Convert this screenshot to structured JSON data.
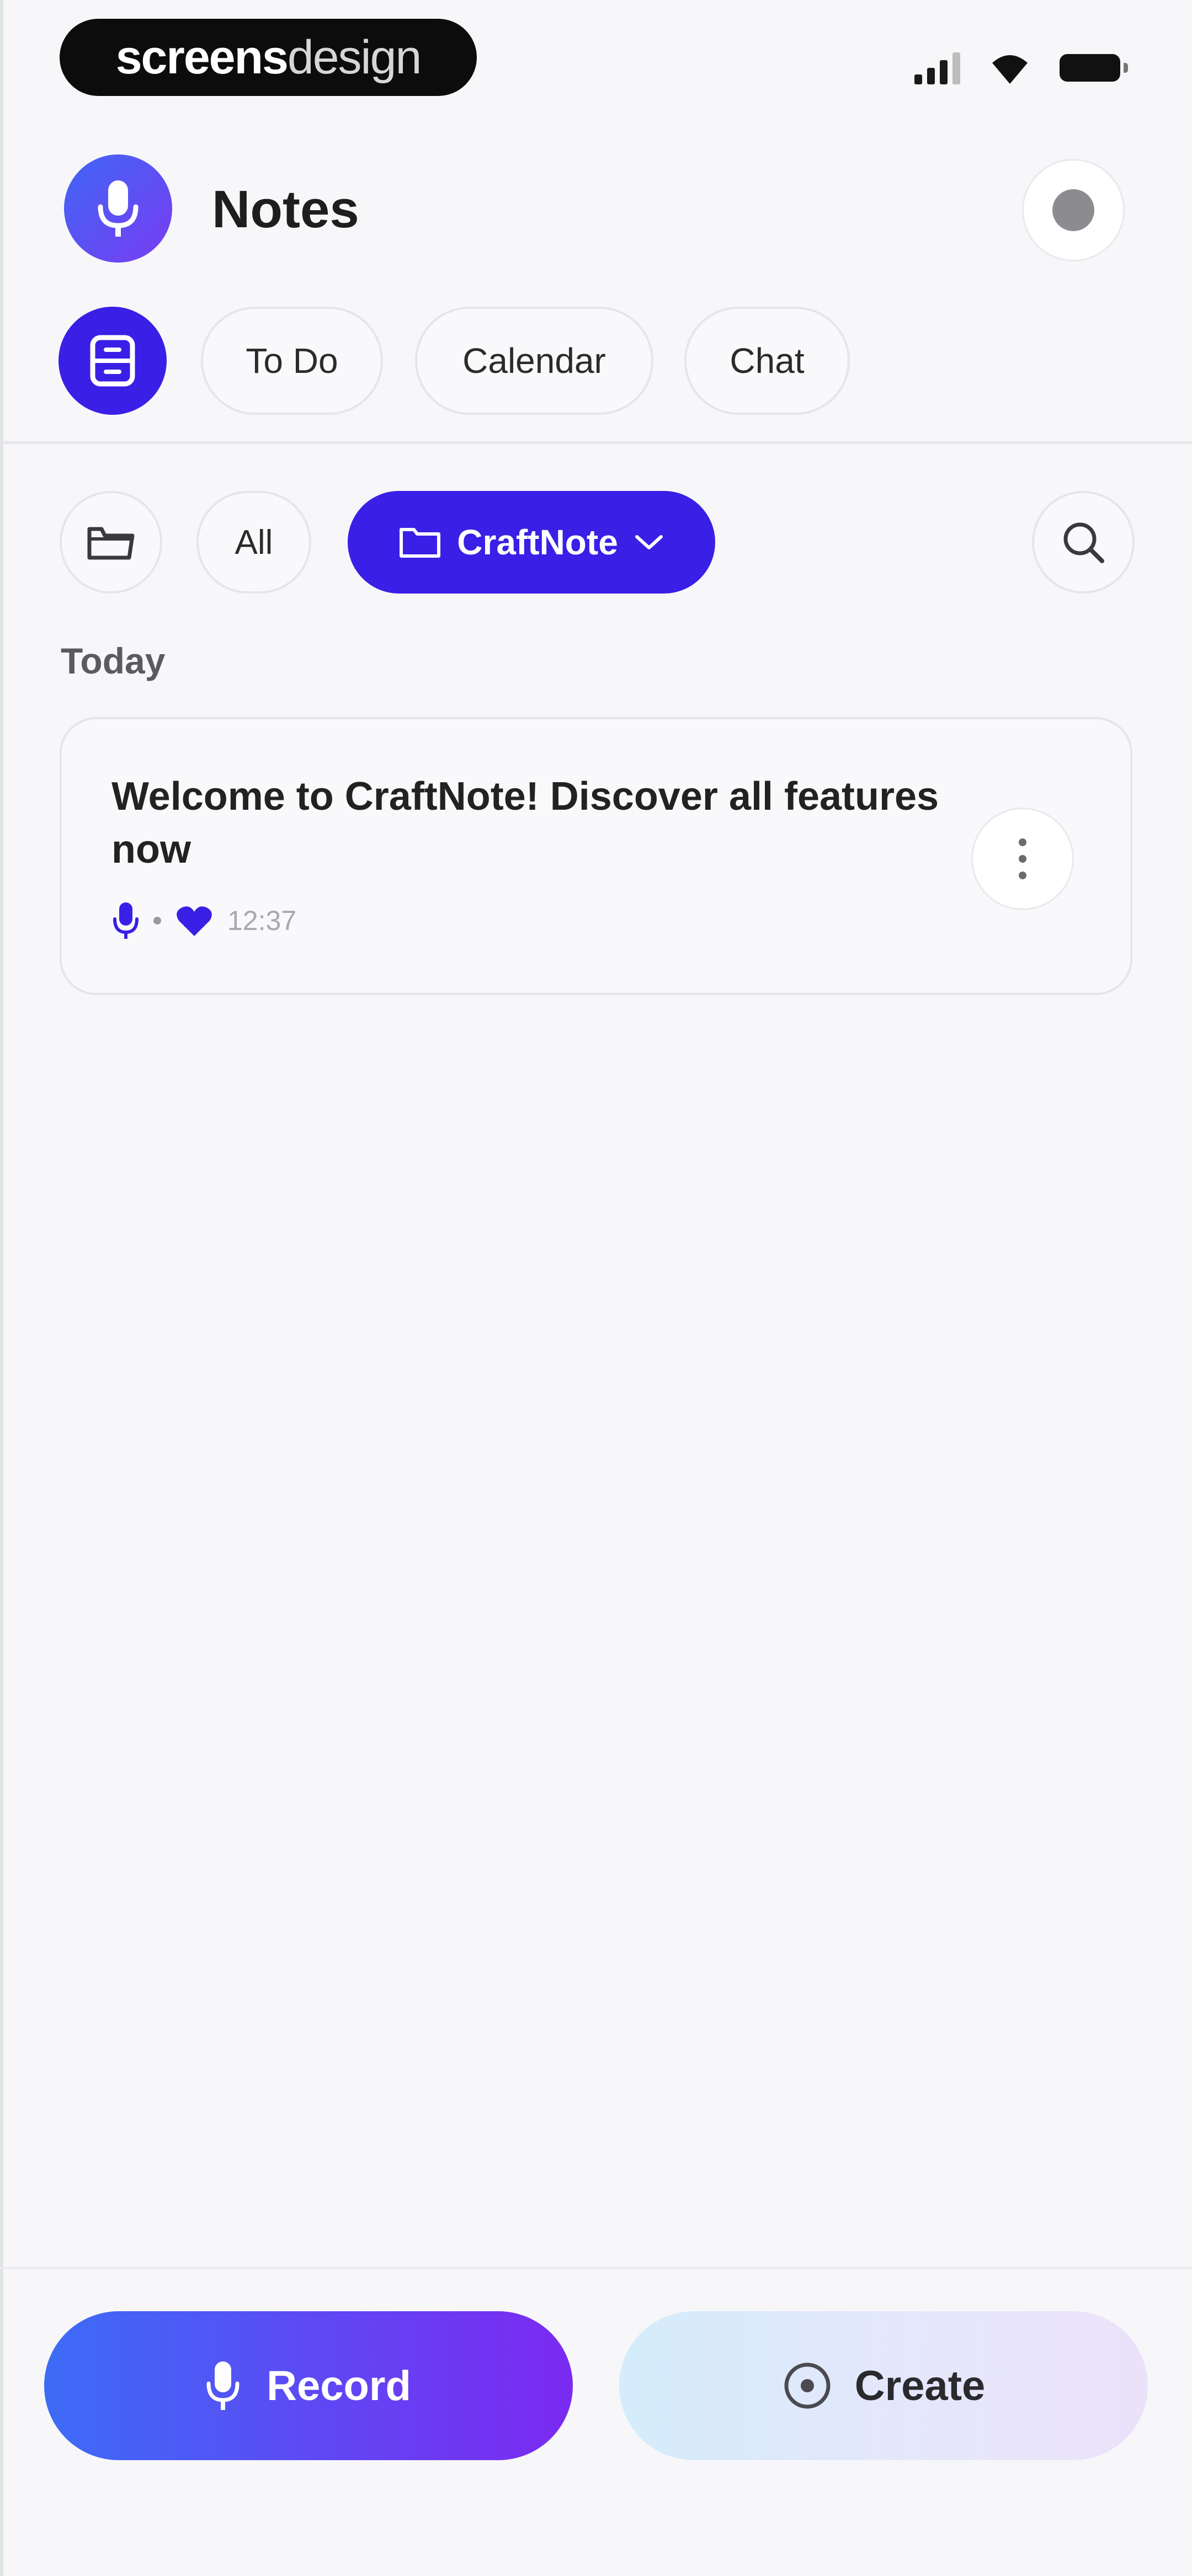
{
  "status_bar": {
    "brand_bold": "screens",
    "brand_light": "design",
    "icons": [
      "signal-icon",
      "wifi-icon",
      "battery-icon"
    ]
  },
  "header": {
    "title": "Notes",
    "avatar_icon": "microphone-icon",
    "settings_icon": "settings-icon"
  },
  "tabs": {
    "active_icon": "document-icon",
    "items": [
      {
        "label": "To Do"
      },
      {
        "label": "Calendar"
      },
      {
        "label": "Chat"
      }
    ]
  },
  "filters": {
    "folder_icon": "folder-icon",
    "all_label": "All",
    "selected_folder": "CraftNote",
    "search_icon": "search-icon"
  },
  "section": {
    "label": "Today"
  },
  "notes": [
    {
      "title": "Welcome to CraftNote! Discover all features now",
      "time": "12:37",
      "icons": [
        "microphone-icon",
        "heart-icon"
      ]
    }
  ],
  "bottom_bar": {
    "record_label": "Record",
    "create_label": "Create"
  },
  "colors": {
    "accent": "#3a1fe6",
    "gradient_start": "#3c6cf6",
    "gradient_end": "#7b2af0",
    "background": "#f7f7f9"
  }
}
